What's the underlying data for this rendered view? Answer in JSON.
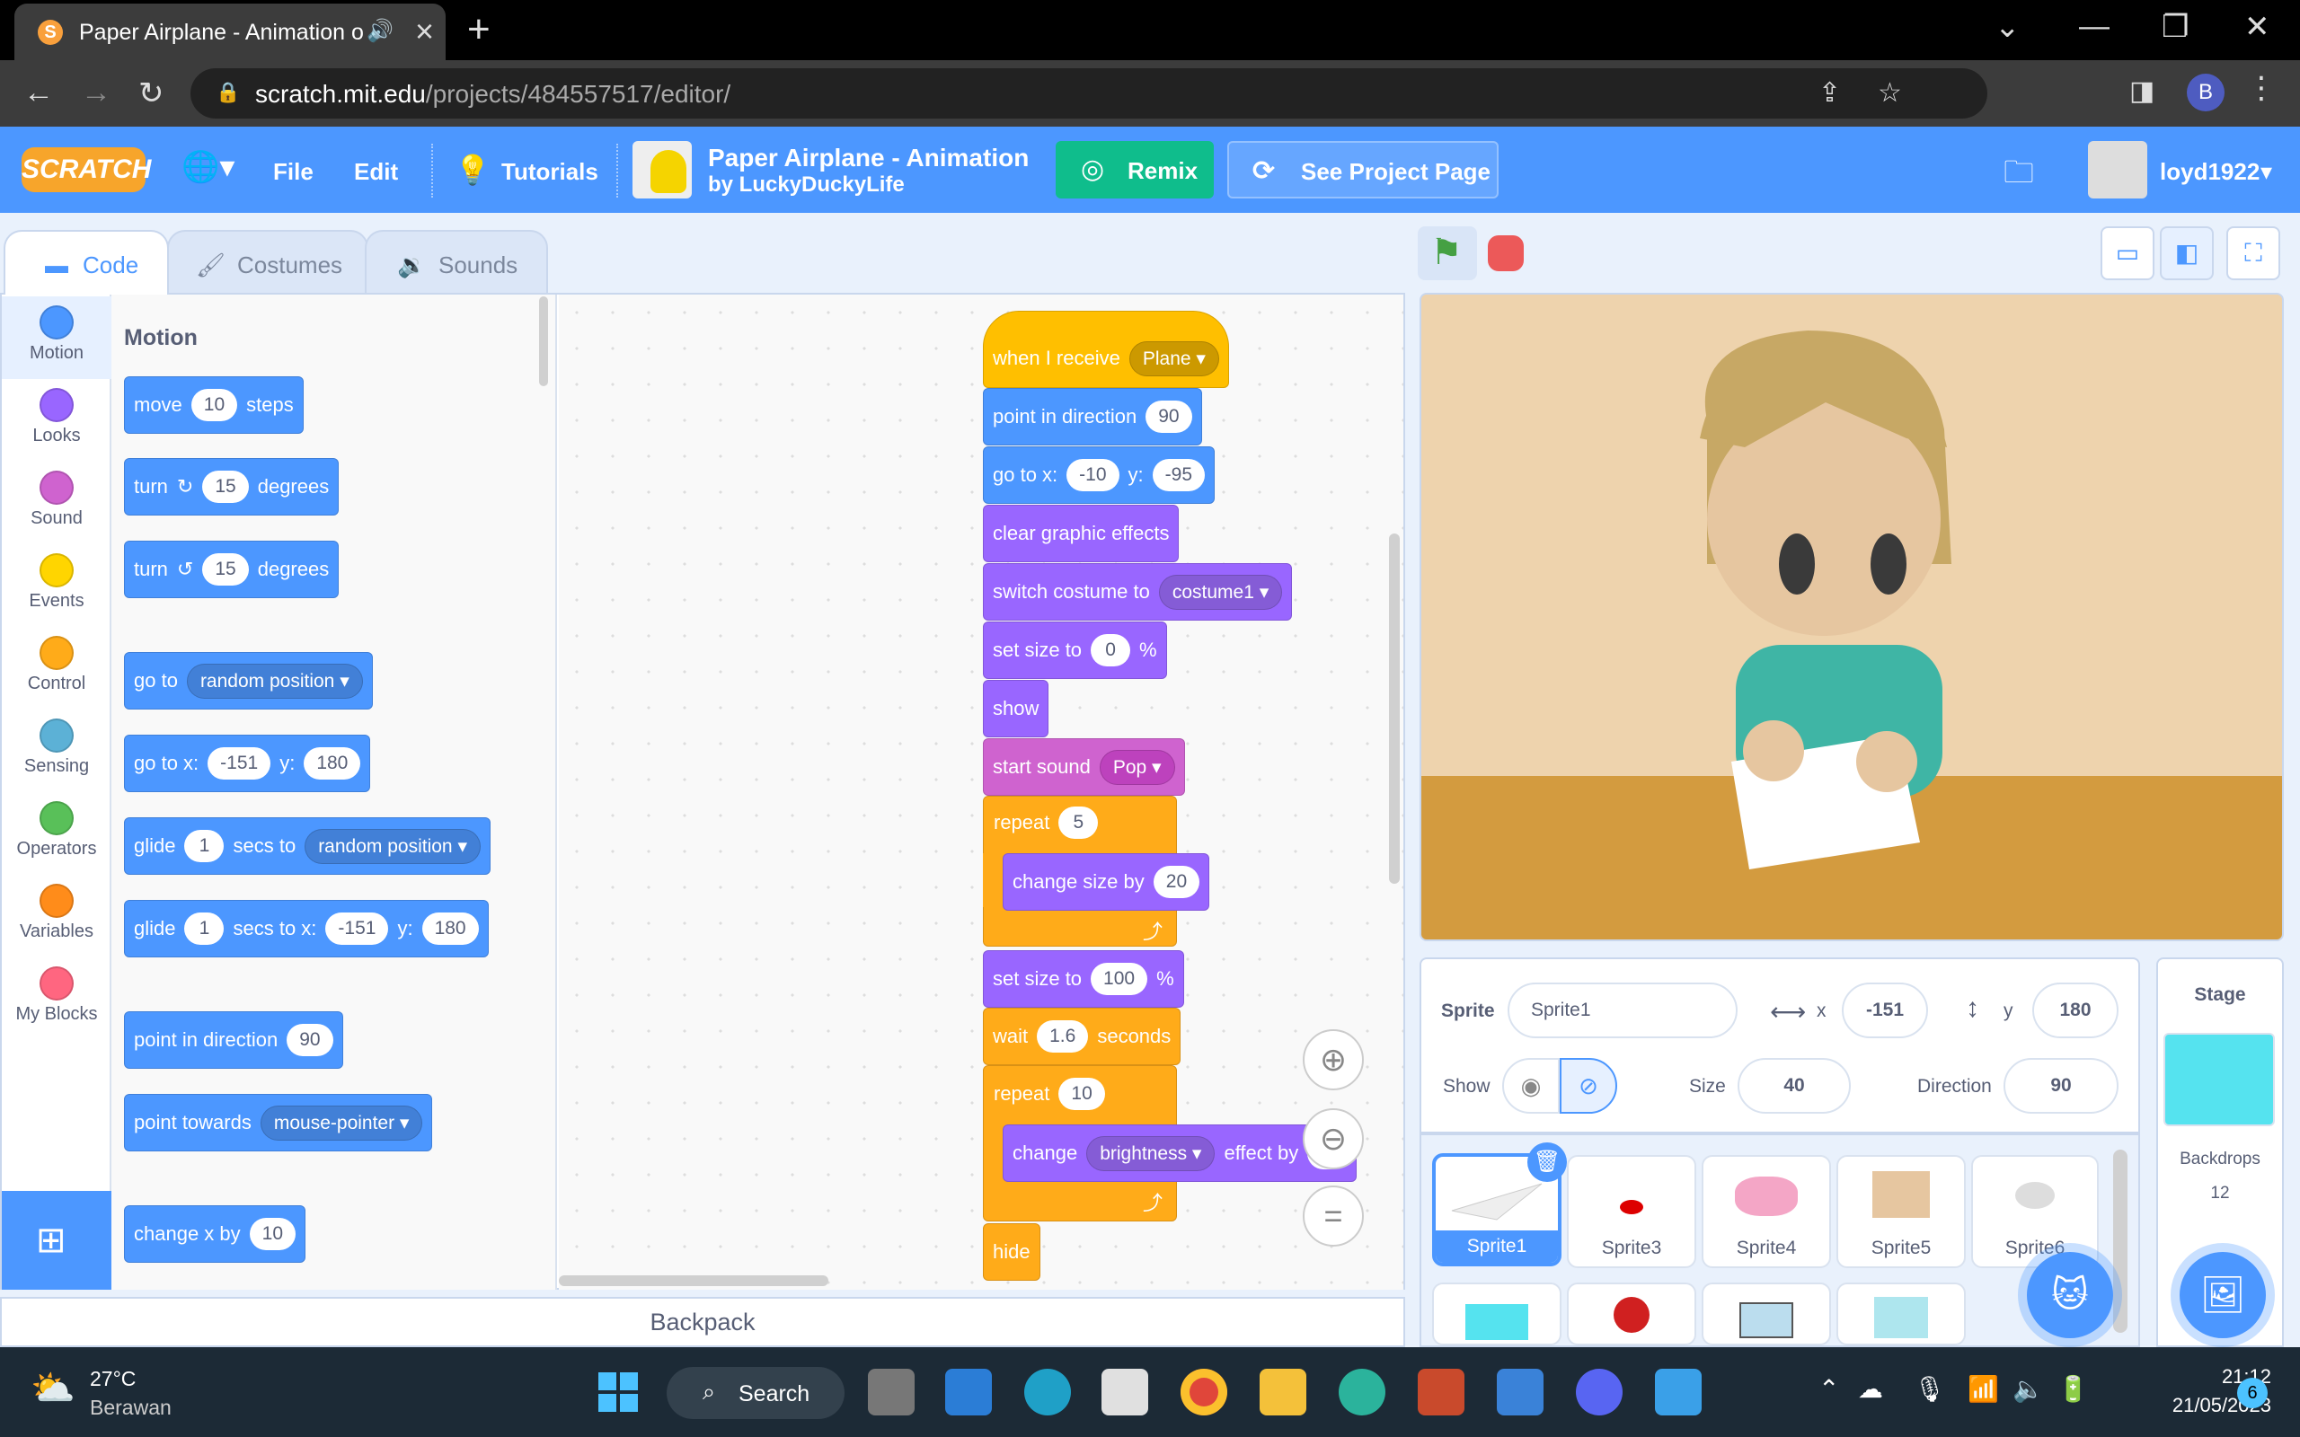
{
  "browser": {
    "tab_title": "Paper Airplane - Animation o",
    "url_domain": "scratch.mit.edu",
    "url_path": "/projects/484557517/editor/",
    "profile_initial": "B"
  },
  "menubar": {
    "logo": "SCRATCH",
    "file": "File",
    "edit": "Edit",
    "tutorials": "Tutorials",
    "project_title": "Paper Airplane - Animation",
    "project_author": "by LuckyDuckyLife",
    "remix": "Remix",
    "see_project_page": "See Project Page",
    "username": "loyd1922"
  },
  "editor_tabs": {
    "code": "Code",
    "costumes": "Costumes",
    "sounds": "Sounds"
  },
  "categories": [
    {
      "label": "Motion",
      "color": "#4c97ff"
    },
    {
      "label": "Looks",
      "color": "#9966ff"
    },
    {
      "label": "Sound",
      "color": "#cf63cf"
    },
    {
      "label": "Events",
      "color": "#ffd500"
    },
    {
      "label": "Control",
      "color": "#ffab19"
    },
    {
      "label": "Sensing",
      "color": "#5cb1d6"
    },
    {
      "label": "Operators",
      "color": "#59c059"
    },
    {
      "label": "Variables",
      "color": "#ff8c1a"
    },
    {
      "label": "My Blocks",
      "color": "#ff6680"
    }
  ],
  "palette": {
    "title": "Motion",
    "move": {
      "a": "move",
      "v": "10",
      "b": "steps"
    },
    "turn_cw": {
      "a": "turn",
      "v": "15",
      "b": "degrees"
    },
    "turn_ccw": {
      "a": "turn",
      "v": "15",
      "b": "degrees"
    },
    "goto": {
      "a": "go to",
      "dd": "random position"
    },
    "gotoxy": {
      "a": "go to x:",
      "x": "-151",
      "b": "y:",
      "y": "180"
    },
    "glide": {
      "a": "glide",
      "v": "1",
      "b": "secs to",
      "dd": "random position"
    },
    "glidexy": {
      "a": "glide",
      "v": "1",
      "b": "secs to x:",
      "x": "-151",
      "c": "y:",
      "y": "180"
    },
    "pointdir": {
      "a": "point in direction",
      "v": "90"
    },
    "pointtowards": {
      "a": "point towards",
      "dd": "mouse-pointer"
    },
    "changex": {
      "a": "change x by",
      "v": "10"
    }
  },
  "script": {
    "when_receive": {
      "a": "when I receive",
      "dd": "Plane"
    },
    "point_dir": {
      "a": "point in direction",
      "v": "90"
    },
    "goto": {
      "a": "go to x:",
      "x": "-10",
      "b": "y:",
      "y": "-95"
    },
    "clear": "clear graphic effects",
    "switch": {
      "a": "switch costume to",
      "dd": "costume1"
    },
    "setsize0": {
      "a": "set size to",
      "v": "0",
      "b": "%"
    },
    "show": "show",
    "startsound": {
      "a": "start sound",
      "dd": "Pop"
    },
    "repeat1": {
      "a": "repeat",
      "v": "5"
    },
    "changesize": {
      "a": "change size by",
      "v": "20"
    },
    "setsize100": {
      "a": "set size to",
      "v": "100",
      "b": "%"
    },
    "wait": {
      "a": "wait",
      "v": "1.6",
      "b": "seconds"
    },
    "repeat2": {
      "a": "repeat",
      "v": "10"
    },
    "change_effect": {
      "a": "change",
      "dd": "brightness",
      "b": "effect by",
      "v": "5"
    },
    "hide": "hide"
  },
  "backpack": "Backpack",
  "sprite_info": {
    "sprite_label": "Sprite",
    "sprite_name": "Sprite1",
    "x_label": "x",
    "x": "-151",
    "y_label": "y",
    "y": "180",
    "show_label": "Show",
    "size_label": "Size",
    "size": "40",
    "direction_label": "Direction",
    "direction": "90"
  },
  "sprites": [
    "Sprite1",
    "Sprite3",
    "Sprite4",
    "Sprite5",
    "Sprite6"
  ],
  "stage_panel": {
    "title": "Stage",
    "backdrops_label": "Backdrops",
    "backdrops_count": "12"
  },
  "taskbar": {
    "temp": "27°C",
    "weather": "Berawan",
    "search": "Search",
    "time": "21:12",
    "date": "21/05/2023",
    "notif": "6"
  }
}
